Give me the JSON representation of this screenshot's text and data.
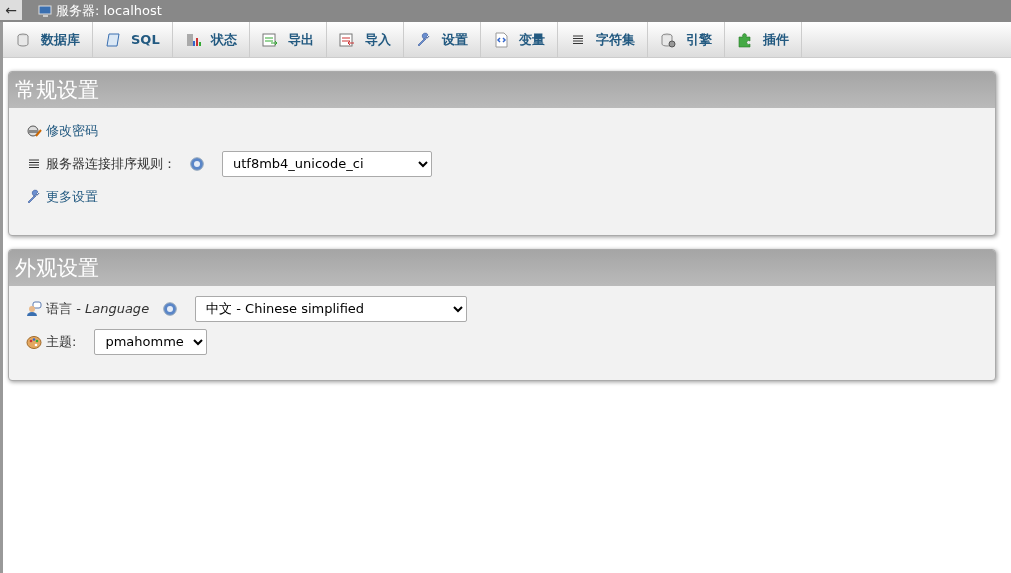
{
  "top_bar": {
    "back_arrow": "←",
    "breadcrumb": "服务器: localhost"
  },
  "tabs": [
    {
      "label": "数据库",
      "selected": false
    },
    {
      "label": "SQL",
      "selected": false
    },
    {
      "label": "状态",
      "selected": false
    },
    {
      "label": "导出",
      "selected": false
    },
    {
      "label": "导入",
      "selected": false
    },
    {
      "label": "设置",
      "selected": false
    },
    {
      "label": "变量",
      "selected": false
    },
    {
      "label": "字符集",
      "selected": false
    },
    {
      "label": "引擎",
      "selected": false
    },
    {
      "label": "插件",
      "selected": false
    }
  ],
  "panels": [
    {
      "title": "常规设置",
      "items": [
        {
          "kind": "link",
          "label": "修改密码"
        },
        {
          "kind": "select",
          "label": "服务器连接排序规则：",
          "help": true,
          "value": "utf8mb4_unicode_ci"
        },
        {
          "kind": "link",
          "label": "更多设置"
        }
      ]
    },
    {
      "title": "外观设置",
      "items": [
        {
          "kind": "select",
          "label": "语言 - *Language*",
          "help": true,
          "value": "中文 - Chinese simplified"
        },
        {
          "kind": "select",
          "label": "主题:",
          "help": false,
          "value": "pmahomme"
        }
      ]
    }
  ]
}
